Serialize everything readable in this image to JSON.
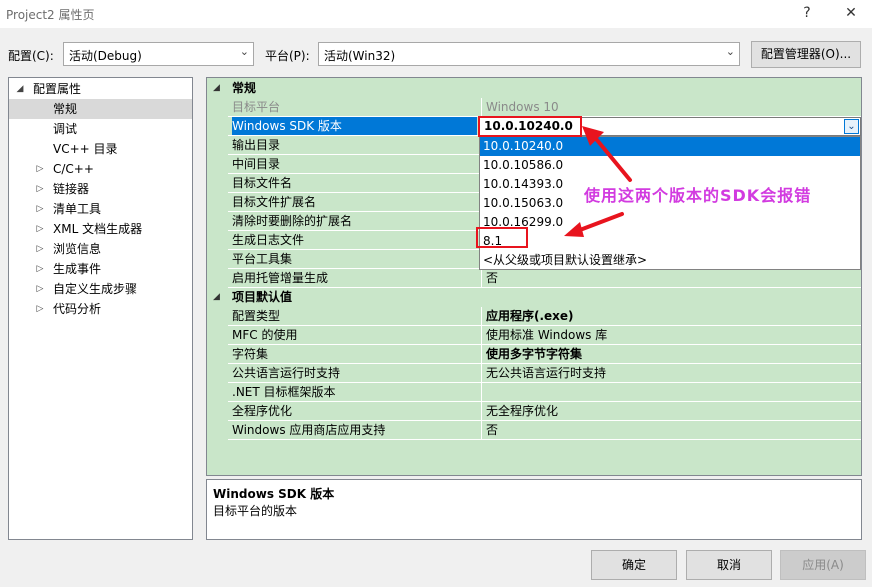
{
  "window": {
    "title": "Project2 属性页",
    "help_glyph": "?",
    "close_glyph": "✕"
  },
  "toolbar": {
    "config_label": "配置(C):",
    "config_value": "活动(Debug)",
    "platform_label": "平台(P):",
    "platform_value": "活动(Win32)",
    "config_manager_label": "配置管理器(O)..."
  },
  "tree": {
    "items": [
      {
        "label": "配置属性",
        "expander": "◢"
      },
      {
        "label": "常规",
        "expander": ""
      },
      {
        "label": "调试",
        "expander": ""
      },
      {
        "label": "VC++ 目录",
        "expander": ""
      },
      {
        "label": "C/C++",
        "expander": "▷"
      },
      {
        "label": "链接器",
        "expander": "▷"
      },
      {
        "label": "清单工具",
        "expander": "▷"
      },
      {
        "label": "XML 文档生成器",
        "expander": "▷"
      },
      {
        "label": "浏览信息",
        "expander": "▷"
      },
      {
        "label": "生成事件",
        "expander": "▷"
      },
      {
        "label": "自定义生成步骤",
        "expander": "▷"
      },
      {
        "label": "代码分析",
        "expander": "▷"
      }
    ]
  },
  "grid": {
    "categories": [
      {
        "label": "常规",
        "expander": "◢"
      },
      {
        "label": "项目默认值",
        "expander": "◢"
      }
    ],
    "general_rows": [
      {
        "name": "目标平台",
        "value": "Windows 10"
      },
      {
        "name": "Windows SDK 版本",
        "value": ""
      },
      {
        "name": "输出目录",
        "value": ""
      },
      {
        "name": "中间目录",
        "value": ""
      },
      {
        "name": "目标文件名",
        "value": ""
      },
      {
        "name": "目标文件扩展名",
        "value": ""
      },
      {
        "name": "清除时要删除的扩展名",
        "value": ""
      },
      {
        "name": "生成日志文件",
        "value": ""
      },
      {
        "name": "平台工具集",
        "value": ""
      },
      {
        "name": "启用托管增量生成",
        "value": "否"
      }
    ],
    "defaults_rows": [
      {
        "name": "配置类型",
        "value": "应用程序(.exe)"
      },
      {
        "name": "MFC 的使用",
        "value": "使用标准 Windows 库"
      },
      {
        "name": "字符集",
        "value": "使用多字节字符集"
      },
      {
        "name": "公共语言运行时支持",
        "value": "无公共语言运行时支持"
      },
      {
        "name": ".NET 目标框架版本",
        "value": ""
      },
      {
        "name": "全程序优化",
        "value": "无全程序优化"
      },
      {
        "name": "Windows 应用商店应用支持",
        "value": "否"
      }
    ]
  },
  "sdk": {
    "selected": "10.0.10240.0",
    "dropdown_glyph": "⌄",
    "options": [
      "10.0.10240.0",
      "10.0.10586.0",
      "10.0.14393.0",
      "10.0.15063.0",
      "10.0.16299.0",
      "8.1",
      "<从父级或项目默认设置继承>"
    ]
  },
  "annotation": {
    "text": "使用这两个版本的SDK会报错",
    "color": "#d23be0",
    "box_color": "#e8141e"
  },
  "description": {
    "title": "Windows SDK 版本",
    "body": "目标平台的版本"
  },
  "buttons": {
    "ok": "确定",
    "cancel": "取消",
    "apply": "应用(A)"
  },
  "colors": {
    "grid_bg": "#c9e6c9",
    "selection": "#0078d7"
  }
}
